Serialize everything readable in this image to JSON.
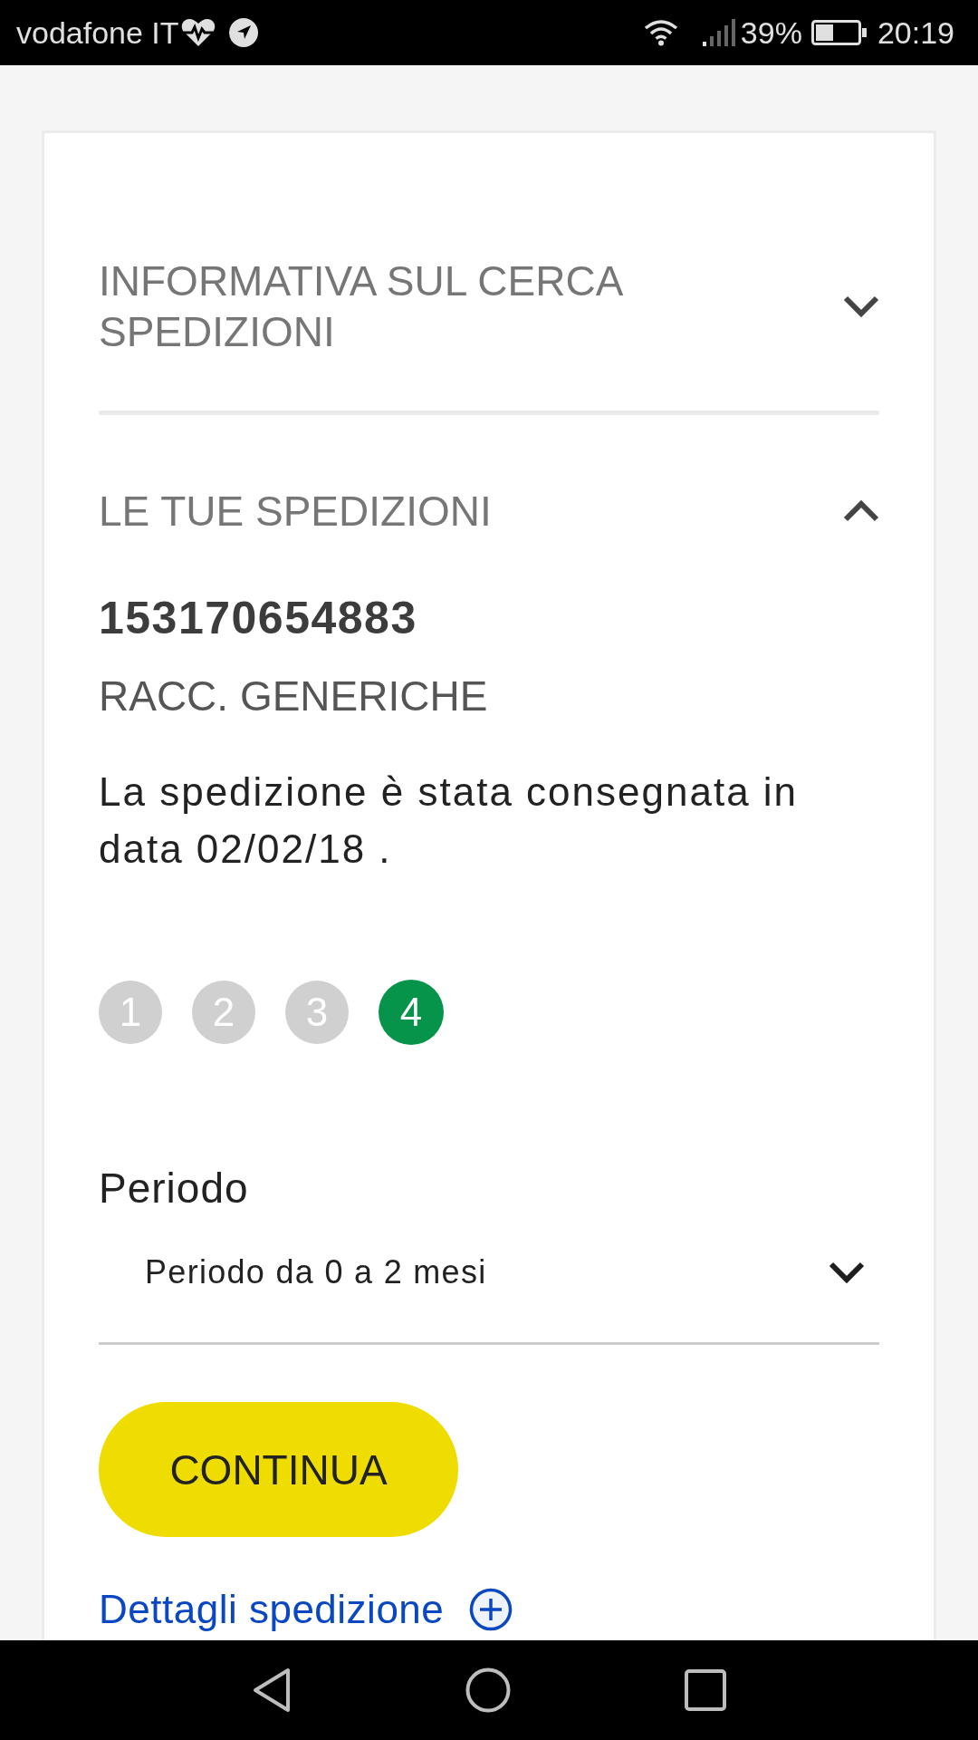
{
  "status_bar": {
    "carrier": "vodafone IT",
    "battery": "39%",
    "time": "20:19"
  },
  "accordions": [
    {
      "title": "INFORMATIVA SUL CERCA SPEDIZIONI",
      "expanded": false
    },
    {
      "title": "LE TUE SPEDIZIONI",
      "expanded": true,
      "shipment": {
        "number": "153170654883",
        "type": "RACC. GENERICHE",
        "status": "La spedizione è stata consegnata in data 02/02/18 .",
        "steps": [
          {
            "label": "1",
            "selected": false
          },
          {
            "label": "2",
            "selected": false
          },
          {
            "label": "3",
            "selected": false
          },
          {
            "label": "4",
            "selected": true
          }
        ]
      },
      "period": {
        "label": "Periodo",
        "value": "Periodo da 0 a 2 mesi"
      },
      "button": "CONTINUA",
      "link": "Dettagli spedizione"
    }
  ]
}
